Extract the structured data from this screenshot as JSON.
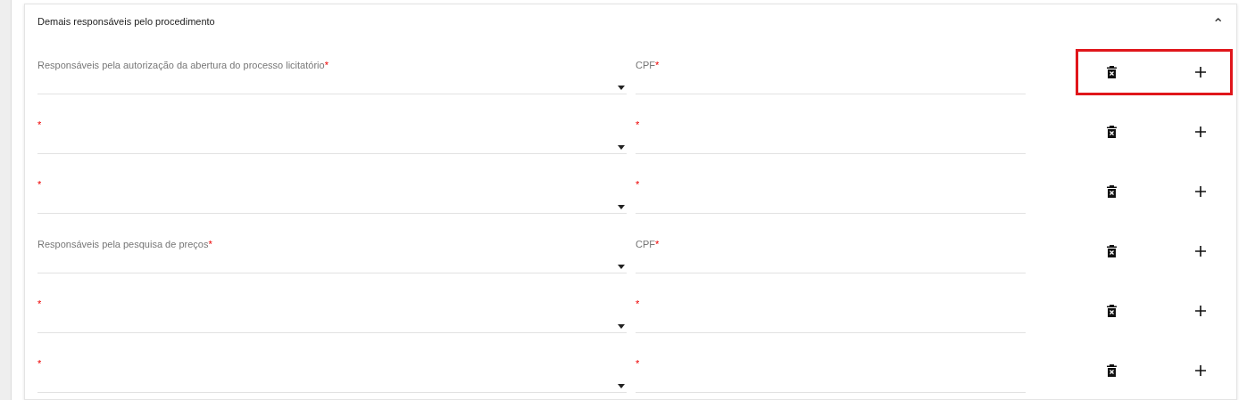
{
  "panel": {
    "title": "Demais responsáveis pelo procedimento",
    "expanded": true,
    "collapse_icon": "⌃"
  },
  "rows": [
    {
      "select": {
        "label": "Responsáveis pela autorização da abertura do processo licitatório",
        "required_mark": "*"
      },
      "cpf": {
        "label": "CPF",
        "required_mark": "*"
      },
      "highlighted": true
    },
    {
      "select": {
        "required_mark": "*"
      },
      "cpf": {
        "required_mark": "*"
      },
      "highlighted": false
    },
    {
      "select": {
        "required_mark": "*"
      },
      "cpf": {
        "required_mark": "*"
      },
      "highlighted": false
    },
    {
      "select": {
        "label": "Responsáveis pela pesquisa de preços",
        "required_mark": "*"
      },
      "cpf": {
        "label": "CPF",
        "required_mark": "*"
      },
      "highlighted": false
    },
    {
      "select": {
        "required_mark": "*"
      },
      "cpf": {
        "required_mark": "*"
      },
      "highlighted": false
    },
    {
      "select": {
        "required_mark": "*"
      },
      "cpf": {
        "required_mark": "*"
      },
      "highlighted": false
    }
  ]
}
